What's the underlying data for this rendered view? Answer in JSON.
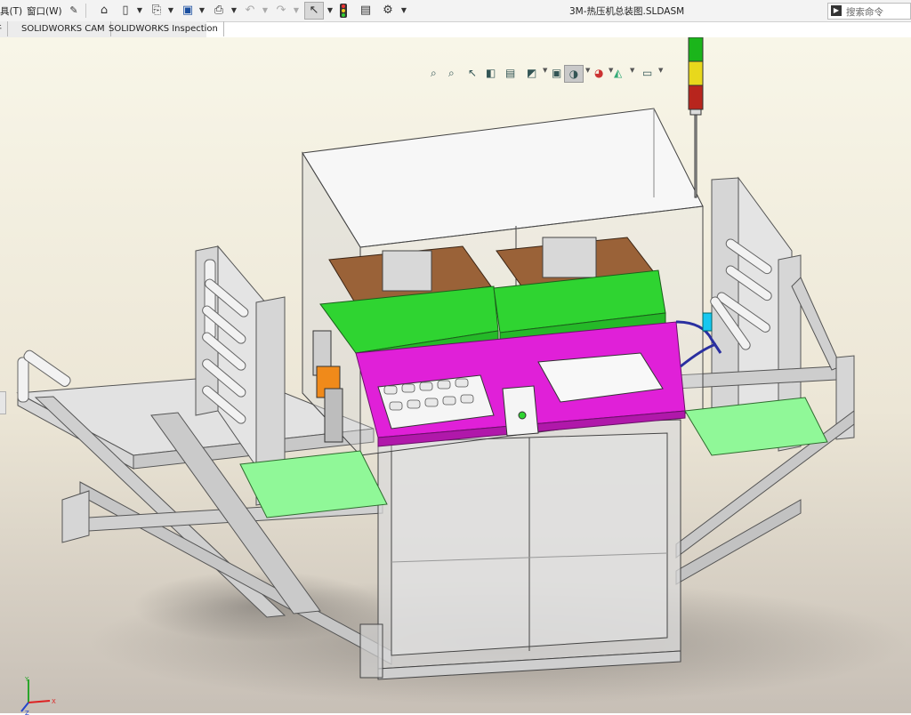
{
  "menu": {
    "tools_partial": "具(T)",
    "window": "窗口(W)"
  },
  "document_title": "3M-热压机总装图.SLDASM",
  "search": {
    "placeholder": "搜索命令"
  },
  "tabs": [
    {
      "label": "插件"
    },
    {
      "label": "SOLIDWORKS CAM"
    },
    {
      "label": "SOLIDWORKS Inspection"
    }
  ],
  "tabs_visible_partial": "件",
  "toolbar_icons": [
    "pin-icon",
    "home-icon",
    "new-document-icon",
    "open-icon",
    "save-icon",
    "print-icon",
    "undo-icon",
    "redo-icon",
    "select-pointer-icon",
    "traffic-light-icon",
    "file-properties-icon",
    "options-gear-icon"
  ],
  "heads_up_icons": [
    "zoom-to-fit-icon",
    "zoom-to-area-icon",
    "previous-view-icon",
    "section-view-icon",
    "dynamic-annotation-icon",
    "view-orientation-icon",
    "display-style-icon",
    "hide-show-icon",
    "edit-appearance-icon",
    "apply-scene-icon",
    "view-settings-icon"
  ],
  "colors": {
    "magenta_plate": "#e020d8",
    "green_plate": "#2fd431",
    "brown_plate": "#9a6238",
    "light_green_shelf": "#90f898",
    "frame_gray": "#d6d6d6",
    "background_top": "#f8f6e8",
    "background_bottom": "#c7bfb6"
  },
  "stack_light": [
    "#1bb51b",
    "#e8d81c",
    "#b8251d"
  ],
  "axes": {
    "x": "X",
    "y": "Y",
    "z": "Z"
  }
}
